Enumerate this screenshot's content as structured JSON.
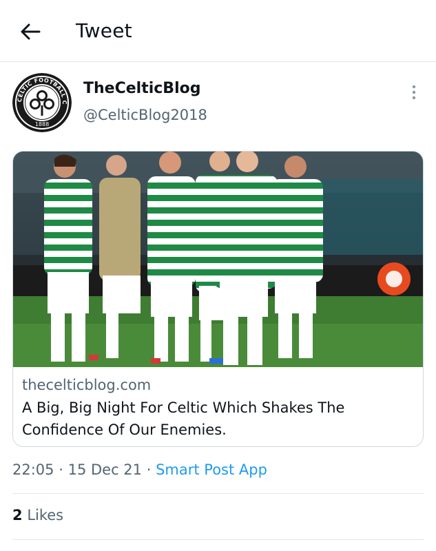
{
  "header": {
    "back_icon": "arrow-left-icon",
    "title": "Tweet"
  },
  "author": {
    "avatar_icon": "celtic-football-club-crest",
    "avatar_text_top": "THE CELTIC FOOTBALL CLUB",
    "avatar_text_bottom": "1888",
    "display_name": "TheCelticBlog",
    "handle": "@CelticBlog2018",
    "more_icon": "more-vertical-icon"
  },
  "link_card": {
    "image_icon": "celtic-players-applauding-photo",
    "domain": "theceltic​blog.com",
    "title": "A Big, Big Night For Celtic Which Shakes The Confidence Of Our Enemies."
  },
  "tweet_meta": {
    "time": "22:05",
    "date": "15 Dec 21",
    "separator": "·",
    "source": "Smart Post App"
  },
  "stats": {
    "likes_count": "2",
    "likes_label": "Likes"
  },
  "colors": {
    "text_primary": "#0f1419",
    "text_secondary": "#536471",
    "accent": "#1d9bf0",
    "border": "#cfd9de",
    "celtic_green": "#1e8a45"
  }
}
